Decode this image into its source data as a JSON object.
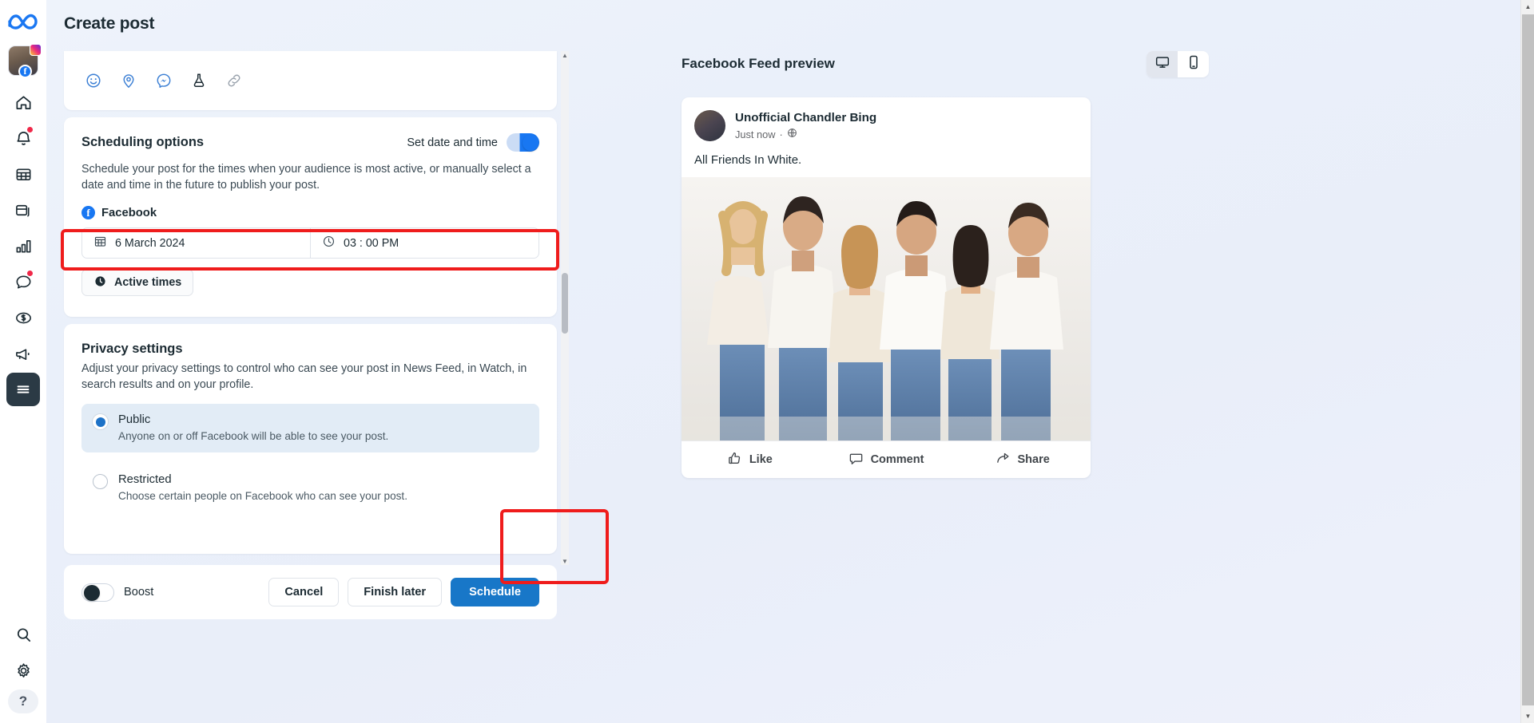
{
  "header": {
    "page_title": "Create post"
  },
  "rail": {
    "logo": "meta-infinity-logo",
    "items": [
      {
        "name": "account-avatar",
        "icon": "avatar"
      },
      {
        "name": "home",
        "icon": "home-icon",
        "badge": false
      },
      {
        "name": "notifications",
        "icon": "bell-icon",
        "badge": true
      },
      {
        "name": "calendar",
        "icon": "calendar-grid-icon",
        "badge": false
      },
      {
        "name": "posts",
        "icon": "cards-icon",
        "badge": false
      },
      {
        "name": "insights",
        "icon": "bar-chart-icon",
        "badge": false
      },
      {
        "name": "inbox",
        "icon": "chat-bubble-icon",
        "badge": true
      },
      {
        "name": "monetization",
        "icon": "dollar-circle-icon",
        "badge": false
      },
      {
        "name": "ads",
        "icon": "megaphone-icon",
        "badge": false
      },
      {
        "name": "menu",
        "icon": "hamburger-icon",
        "badge": false,
        "active": true
      }
    ],
    "bottom": [
      {
        "name": "search",
        "icon": "search-icon"
      },
      {
        "name": "settings",
        "icon": "gear-icon"
      },
      {
        "name": "help",
        "icon": "question-mark",
        "label": "?"
      }
    ]
  },
  "composer": {
    "attachments": [
      {
        "name": "emoji-icon",
        "label": "Emoji"
      },
      {
        "name": "location-pin-icon",
        "label": "Location"
      },
      {
        "name": "messenger-icon",
        "label": "Messenger"
      },
      {
        "name": "flask-icon",
        "label": "Experiment"
      },
      {
        "name": "link-icon",
        "label": "Link"
      }
    ],
    "scheduling": {
      "title": "Scheduling options",
      "toggle_label": "Set date and time",
      "toggle_on": true,
      "description": "Schedule your post for the times when your audience is most active, or manually select a date and time in the future to publish your post.",
      "platform": "Facebook",
      "date_value": "6 March 2024",
      "time_value": "03 : 00 PM",
      "active_times_label": "Active times"
    },
    "privacy": {
      "title": "Privacy settings",
      "description": "Adjust your privacy settings to control who can see your post in News Feed, in Watch, in search results and on your profile.",
      "options": [
        {
          "label": "Public",
          "description": "Anyone on or off Facebook will be able to see your post.",
          "selected": true
        },
        {
          "label": "Restricted",
          "description": "Choose certain people on Facebook who can see your post.",
          "selected": false
        }
      ]
    },
    "footer": {
      "boost_label": "Boost",
      "boost_on": false,
      "cancel_label": "Cancel",
      "finish_later_label": "Finish later",
      "schedule_label": "Schedule"
    }
  },
  "preview": {
    "title": "Facebook Feed preview",
    "view_toggle": [
      {
        "name": "desktop-view",
        "icon": "monitor-icon",
        "active": true
      },
      {
        "name": "mobile-view",
        "icon": "phone-icon",
        "active": false
      }
    ],
    "post": {
      "account_name": "Unofficial Chandler Bing",
      "timestamp": "Just now",
      "audience_icon": "globe-icon",
      "separator": "·",
      "text": "All Friends In White.",
      "actions": [
        {
          "label": "Like",
          "icon": "thumbs-up-icon"
        },
        {
          "label": "Comment",
          "icon": "comment-bubble-icon"
        },
        {
          "label": "Share",
          "icon": "share-arrow-icon"
        }
      ]
    }
  },
  "annotations": [
    {
      "name": "datetime-highlight",
      "color": "#ef1c1c"
    },
    {
      "name": "schedule-button-highlight",
      "color": "#ef1c1c"
    }
  ],
  "colors": {
    "accent_blue": "#1877f2",
    "primary_button": "#1877c8",
    "annotation_red": "#ef1c1c",
    "selected_row": "#e2ecf6"
  }
}
